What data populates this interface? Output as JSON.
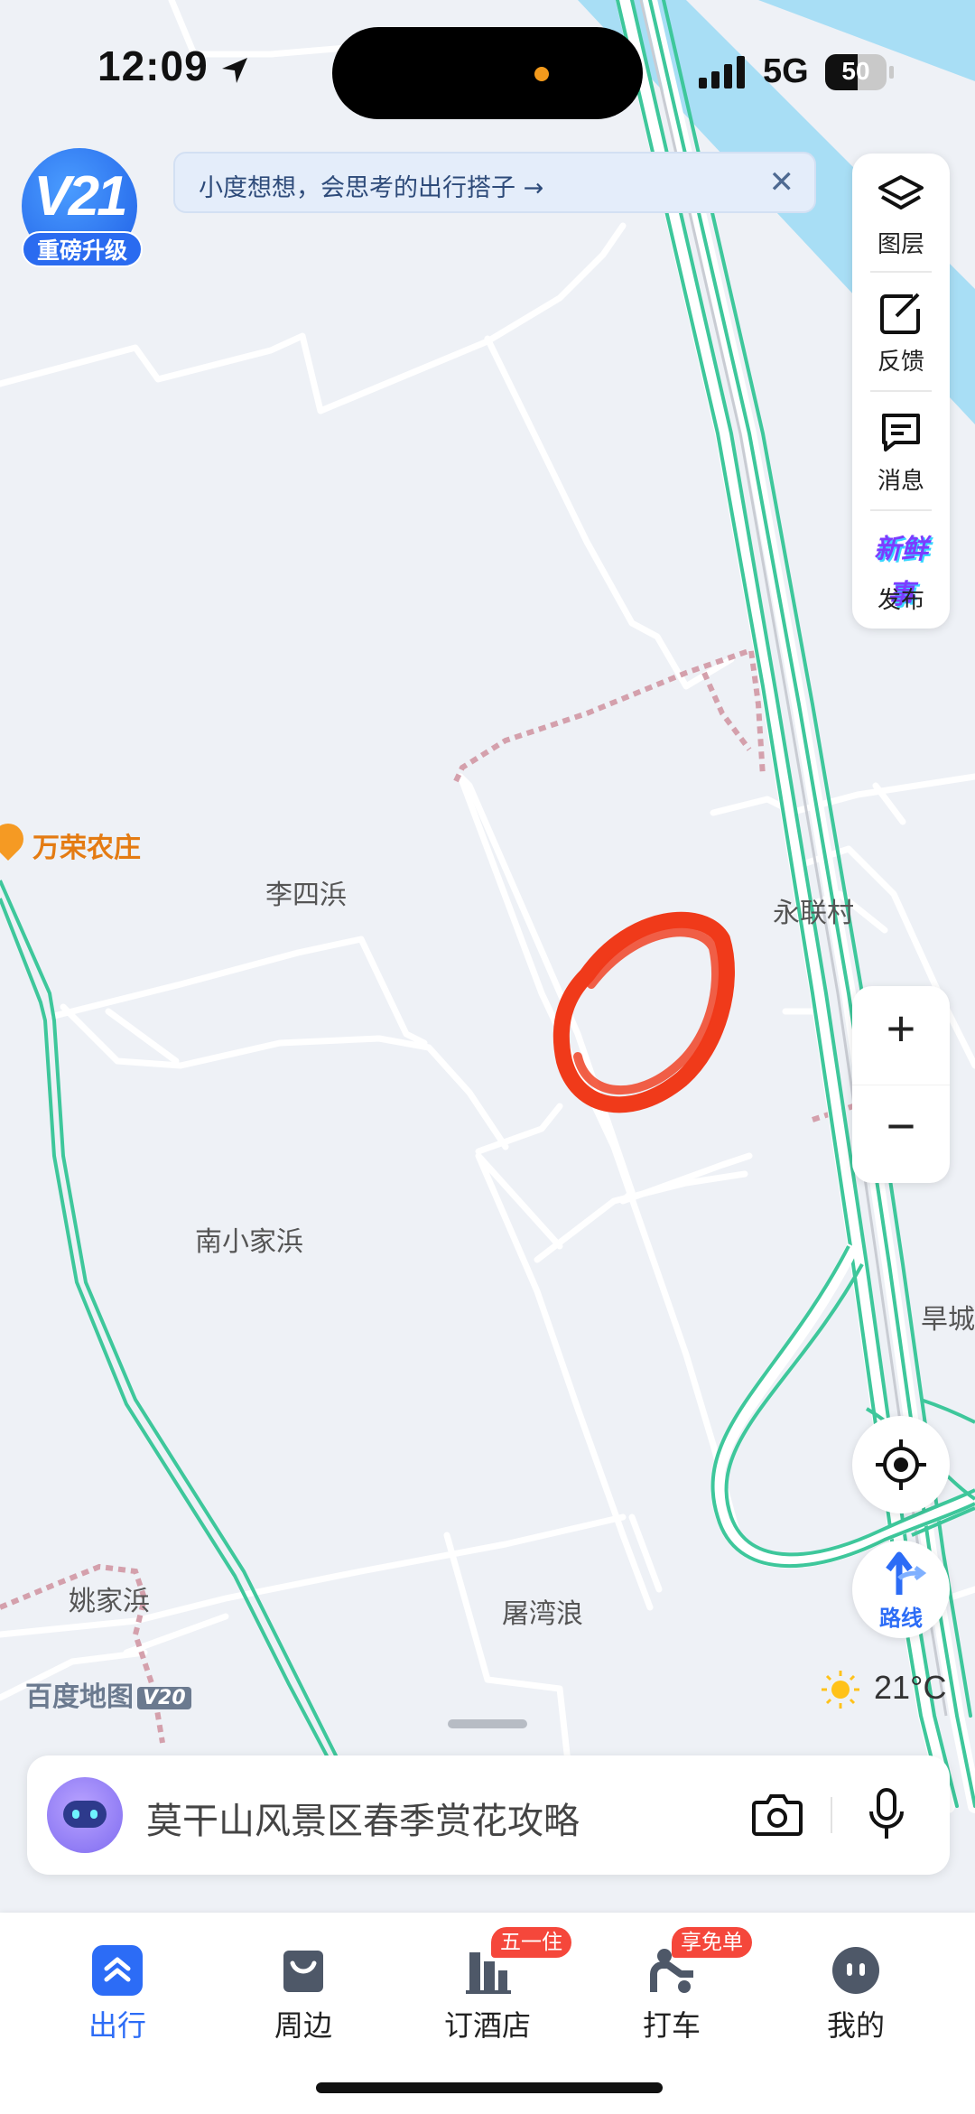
{
  "status_bar": {
    "time": "12:09",
    "network": "5G",
    "battery": "50"
  },
  "version_badge": {
    "version": "V21",
    "label": "重磅升级"
  },
  "banner": {
    "text": "小度想想，会思考的出行搭子 →",
    "close": "✕"
  },
  "right_panel": [
    {
      "label": "图层",
      "icon": "layers-icon"
    },
    {
      "label": "反馈",
      "icon": "feedback-icon"
    },
    {
      "label": "消息",
      "icon": "message-icon"
    },
    {
      "badge": "新鲜事",
      "label": "发布",
      "icon": "publish-icon"
    }
  ],
  "map_labels": {
    "wanrong": "万荣农庄",
    "lisibang": "李四浜",
    "yonglian": "永联村",
    "nanxiaojia": "南小家浜",
    "hancheng": "旱城",
    "yaojia": "姚家浜",
    "tuwanlang": "屠湾浪"
  },
  "zoom": {
    "plus": "+",
    "minus": "−"
  },
  "route_button": {
    "label": "路线"
  },
  "weather": {
    "temp": "21°C",
    "icon": "sun-icon"
  },
  "logo": {
    "text": "百度地图",
    "version": "V20"
  },
  "search": {
    "query": "莫干山风景区春季赏花攻略"
  },
  "tabs": [
    {
      "label": "出行",
      "active": true
    },
    {
      "label": "周边"
    },
    {
      "label": "订酒店",
      "badge": "五一住"
    },
    {
      "label": "打车",
      "badge": "享免单"
    },
    {
      "label": "我的"
    }
  ],
  "colors": {
    "accent": "#2c6cf6",
    "road_green": "#3ec79b",
    "annotation_red": "#f03a1a",
    "poi_orange": "#e47b12"
  }
}
